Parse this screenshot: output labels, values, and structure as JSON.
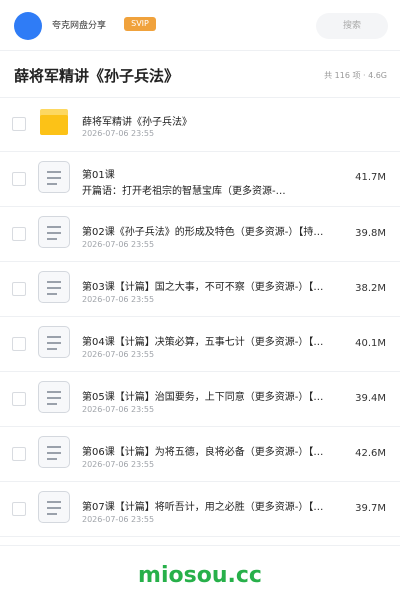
{
  "app": {
    "name": "夸克网盘分享",
    "badge": "SVIP"
  },
  "search": {
    "placeholder": "搜索"
  },
  "folder": {
    "title": "薛将军精讲《孙子兵法》",
    "summary": "共 116 项 · 4.6G"
  },
  "items": [
    {
      "type": "folder",
      "title": "薛将军精讲《孙子兵法》",
      "date": "2026-07-06 23:55",
      "size": ""
    },
    {
      "type": "file",
      "title": "第01课",
      "subtitle": "开篇语：打开老祖宗的智慧宝库（更多资源-…",
      "date": "",
      "size": "41.7M"
    },
    {
      "type": "file",
      "title": "第02课《孙子兵法》的形成及特色（更多资源-）【持…",
      "date": "2026-07-06 23:55",
      "size": "39.8M"
    },
    {
      "type": "file",
      "title": "第03课【计篇】国之大事，不可不察（更多资源-）【…",
      "date": "2026-07-06 23:55",
      "size": "38.2M"
    },
    {
      "type": "file",
      "title": "第04课【计篇】决策必算，五事七计（更多资源-）【…",
      "date": "2026-07-06 23:55",
      "size": "40.1M"
    },
    {
      "type": "file",
      "title": "第05课【计篇】治国要务，上下同意（更多资源-）【…",
      "date": "2026-07-06 23:55",
      "size": "39.4M"
    },
    {
      "type": "file",
      "title": "第06课【计篇】为将五德，良将必备（更多资源-）【…",
      "date": "2026-07-06 23:55",
      "size": "42.6M"
    },
    {
      "type": "file",
      "title": "第07课【计篇】将听吾计，用之必胜（更多资源-）【…",
      "date": "2026-07-06 23:55",
      "size": "39.7M"
    }
  ],
  "watermark": "miosou.cc",
  "colors": {
    "accent": "#2f7cf6",
    "svip": "#f0a23c",
    "folder": "#fcc217",
    "watermark": "#27b04a"
  }
}
